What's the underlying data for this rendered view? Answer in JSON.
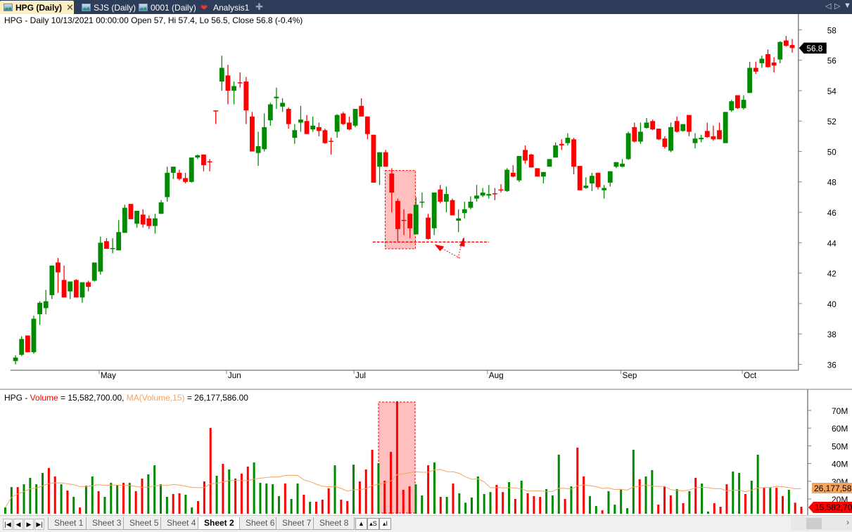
{
  "tabs": [
    {
      "label": "HPG (Daily)",
      "active": true,
      "icon": "chart-icon"
    },
    {
      "label": "SJS (Daily)",
      "active": false,
      "icon": "chart-icon"
    },
    {
      "label": "0001 (Daily)",
      "active": false,
      "icon": "chart-icon"
    },
    {
      "label": "Analysis1",
      "active": false,
      "icon": "analysis-icon"
    }
  ],
  "tab_close": "✕",
  "tab_add": "✚",
  "tab_nav": {
    "prev": "◁",
    "next": "▷",
    "menu": "▼"
  },
  "price_header": "HPG - Daily 10/13/2021 00:00:00 Open 57, Hi 57.4, Lo 56.5, Close 56.8 (-0.4%)",
  "volume_header": {
    "prefix": "HPG - ",
    "vol_label": "Volume",
    "vol_value": " = 15,582,700.00, ",
    "ma_label": "MA(Volume,15)",
    "ma_value": " = 26,177,586.00"
  },
  "price_axis": {
    "ticks": [
      36,
      38,
      40,
      42,
      44,
      46,
      48,
      50,
      52,
      54,
      56,
      58
    ],
    "last_label": "56.8"
  },
  "volume_axis": {
    "ticks": [
      {
        "v": 20,
        "l": "20M"
      },
      {
        "v": 30,
        "l": "30M"
      },
      {
        "v": 40,
        "l": "40M"
      },
      {
        "v": 50,
        "l": "50M"
      },
      {
        "v": 60,
        "l": "60M"
      },
      {
        "v": 70,
        "l": "70M"
      }
    ],
    "ma_tag": "26,177,58",
    "vol_tag": "15,582,70"
  },
  "months": [
    {
      "label": "May",
      "bar": 14
    },
    {
      "label": "Jun",
      "bar": 35
    },
    {
      "label": "Jul",
      "bar": 56
    },
    {
      "label": "Aug",
      "bar": 78
    },
    {
      "label": "Sep",
      "bar": 100
    },
    {
      "label": "Oct",
      "bar": 120
    }
  ],
  "colors": {
    "up": "#008a00",
    "down": "#ff0000",
    "ma": "#f7a35c",
    "highlight": "#ffbfbf",
    "tab_bar": "#2d3c58",
    "active_tab": "#fbeec0"
  },
  "ohlc": [
    [
      36.22,
      36.6,
      36.0,
      36.45
    ],
    [
      36.63,
      37.85,
      36.55,
      37.67
    ],
    [
      37.9,
      37.9,
      36.8,
      36.8
    ],
    [
      36.8,
      39.2,
      36.7,
      39.0
    ],
    [
      39.3,
      40.15,
      38.6,
      40.05
    ],
    [
      39.7,
      40.9,
      39.3,
      40.15
    ],
    [
      40.55,
      42.5,
      40.3,
      42.5
    ],
    [
      42.7,
      43.0,
      40.7,
      42.05
    ],
    [
      41.55,
      42.5,
      40.4,
      40.4
    ],
    [
      40.8,
      41.45,
      40.3,
      41.45
    ],
    [
      41.55,
      41.6,
      40.4,
      40.4
    ],
    [
      40.4,
      41.4,
      40.05,
      41.4
    ],
    [
      41.4,
      41.5,
      40.8,
      41.1
    ],
    [
      41.5,
      42.7,
      41.45,
      42.7
    ],
    [
      42.1,
      44.4,
      41.9,
      44.0
    ],
    [
      44.1,
      44.3,
      43.6,
      43.6
    ],
    [
      43.6,
      44.3,
      43.3,
      43.65
    ],
    [
      43.5,
      45.5,
      43.5,
      44.7
    ],
    [
      44.65,
      46.5,
      44.65,
      46.3
    ],
    [
      46.55,
      46.55,
      45.55,
      45.55
    ],
    [
      45.25,
      46.1,
      45.0,
      46.1
    ],
    [
      45.85,
      46.2,
      45.0,
      45.2
    ],
    [
      45.6,
      45.8,
      44.9,
      45.1
    ],
    [
      45.1,
      45.9,
      44.6,
      45.6
    ],
    [
      45.9,
      46.8,
      45.9,
      46.65
    ],
    [
      47.0,
      49.0,
      46.7,
      48.6
    ],
    [
      48.6,
      49.0,
      48.2,
      49.0
    ],
    [
      48.6,
      48.8,
      48.1,
      48.2
    ],
    [
      48.25,
      48.6,
      47.9,
      48.0
    ],
    [
      48.0,
      49.6,
      47.95,
      49.6
    ],
    [
      49.6,
      49.8,
      49.5,
      49.75
    ],
    [
      49.8,
      49.8,
      48.7,
      49.1
    ],
    [
      49.35,
      49.5,
      48.7,
      49.3
    ],
    [
      52.7,
      52.7,
      51.8,
      52.65
    ],
    [
      54.6,
      56.3,
      54.0,
      55.5
    ],
    [
      55.0,
      55.7,
      53.1,
      54.0
    ],
    [
      54.0,
      54.6,
      53.1,
      54.3
    ],
    [
      54.55,
      55.2,
      54.2,
      54.5
    ],
    [
      54.6,
      54.9,
      51.8,
      52.7
    ],
    [
      52.3,
      52.6,
      50.0,
      50.0
    ],
    [
      49.9,
      51.3,
      49.05,
      50.35
    ],
    [
      50.15,
      52.5,
      50.0,
      51.6
    ],
    [
      52.05,
      53.2,
      51.7,
      53.1
    ],
    [
      53.5,
      54.2,
      52.8,
      53.6
    ],
    [
      52.95,
      53.5,
      52.6,
      53.2
    ],
    [
      52.8,
      52.9,
      51.5,
      51.8
    ],
    [
      50.9,
      51.8,
      50.5,
      51.4
    ],
    [
      51.9,
      53.0,
      51.3,
      52.1
    ],
    [
      52.0,
      52.4,
      51.15,
      51.15
    ],
    [
      51.45,
      52.3,
      51.3,
      51.7
    ],
    [
      51.6,
      51.9,
      51.0,
      51.35
    ],
    [
      51.4,
      51.5,
      50.5,
      50.55
    ],
    [
      50.7,
      50.9,
      49.8,
      50.65
    ],
    [
      51.3,
      52.45,
      50.9,
      52.4
    ],
    [
      52.5,
      52.6,
      51.75,
      51.8
    ],
    [
      51.9,
      52.3,
      51.4,
      51.45
    ],
    [
      51.7,
      52.8,
      51.6,
      52.8
    ],
    [
      53.0,
      53.5,
      52.3,
      52.3
    ],
    [
      52.3,
      52.3,
      50.8,
      51.15
    ],
    [
      51.1,
      51.1,
      47.95,
      47.95
    ],
    [
      49.0,
      49.95,
      47.8,
      49.95
    ],
    [
      49.95,
      50.1,
      49.0,
      49.0
    ],
    [
      48.55,
      48.9,
      46.0,
      47.3
    ],
    [
      46.75,
      46.9,
      44.1,
      44.9
    ],
    [
      45.5,
      46.2,
      44.5,
      45.45
    ],
    [
      45.9,
      45.95,
      44.3,
      44.95
    ],
    [
      44.55,
      47.0,
      44.55,
      46.5
    ],
    [
      46.65,
      47.3,
      46.3,
      46.7
    ],
    [
      45.65,
      45.9,
      44.2,
      44.25
    ],
    [
      44.95,
      47.3,
      44.5,
      47.3
    ],
    [
      47.5,
      47.8,
      46.6,
      46.7
    ],
    [
      46.7,
      47.7,
      46.0,
      47.2
    ],
    [
      46.8,
      46.9,
      45.8,
      45.8
    ],
    [
      45.45,
      46.2,
      44.7,
      45.6
    ],
    [
      45.95,
      46.7,
      45.6,
      46.2
    ],
    [
      46.3,
      47.05,
      46.2,
      46.7
    ],
    [
      46.9,
      47.8,
      46.7,
      47.1
    ],
    [
      47.1,
      47.6,
      47.0,
      47.3
    ],
    [
      47.1,
      47.8,
      46.9,
      47.2
    ],
    [
      47.25,
      47.6,
      46.8,
      47.2
    ],
    [
      47.5,
      47.85,
      47.3,
      47.45
    ],
    [
      47.4,
      48.9,
      47.35,
      48.8
    ],
    [
      48.6,
      49.1,
      48.3,
      48.35
    ],
    [
      48.1,
      49.7,
      48.0,
      49.7
    ],
    [
      50.1,
      50.4,
      49.2,
      49.4
    ],
    [
      49.8,
      49.85,
      48.95,
      48.95
    ],
    [
      48.9,
      48.9,
      48.35,
      48.35
    ],
    [
      48.35,
      48.65,
      47.9,
      48.65
    ],
    [
      49.0,
      49.5,
      49.0,
      49.5
    ],
    [
      49.6,
      50.6,
      49.6,
      50.4
    ],
    [
      50.5,
      50.8,
      50.1,
      50.4
    ],
    [
      50.55,
      51.2,
      50.4,
      50.9
    ],
    [
      50.8,
      50.9,
      48.5,
      49.0
    ],
    [
      49.05,
      49.05,
      47.45,
      47.45
    ],
    [
      47.6,
      48.3,
      47.55,
      47.75
    ],
    [
      47.9,
      48.6,
      47.4,
      48.4
    ],
    [
      48.6,
      48.6,
      47.5,
      47.65
    ],
    [
      47.45,
      47.8,
      46.9,
      47.6
    ],
    [
      47.95,
      48.7,
      47.7,
      48.7
    ],
    [
      49.0,
      49.3,
      48.9,
      49.3
    ],
    [
      49.0,
      49.5,
      48.95,
      49.2
    ],
    [
      49.5,
      51.3,
      49.45,
      51.2
    ],
    [
      51.6,
      51.9,
      50.6,
      50.65
    ],
    [
      50.65,
      51.9,
      50.5,
      51.3
    ],
    [
      51.55,
      52.2,
      51.5,
      51.9
    ],
    [
      52.0,
      52.1,
      51.4,
      51.45
    ],
    [
      51.5,
      51.5,
      50.75,
      50.8
    ],
    [
      50.85,
      51.0,
      50.2,
      50.3
    ],
    [
      50.05,
      51.9,
      49.95,
      51.6
    ],
    [
      52.0,
      52.3,
      51.25,
      51.3
    ],
    [
      51.35,
      51.8,
      51.3,
      51.8
    ],
    [
      52.4,
      52.4,
      51.0,
      51.3
    ],
    [
      50.55,
      51.2,
      50.2,
      50.85
    ],
    [
      50.8,
      51.1,
      50.6,
      50.9
    ],
    [
      51.35,
      51.9,
      50.9,
      50.95
    ],
    [
      51.0,
      51.7,
      50.7,
      50.8
    ],
    [
      51.4,
      51.9,
      50.8,
      50.8
    ],
    [
      50.55,
      52.6,
      50.55,
      52.6
    ],
    [
      52.7,
      53.4,
      52.6,
      53.3
    ],
    [
      53.7,
      53.7,
      52.8,
      52.85
    ],
    [
      52.85,
      53.7,
      52.75,
      53.4
    ],
    [
      53.85,
      55.9,
      53.85,
      55.5
    ],
    [
      55.5,
      55.9,
      55.1,
      55.25
    ],
    [
      55.8,
      56.3,
      55.5,
      56.1
    ],
    [
      56.4,
      56.7,
      55.5,
      55.55
    ],
    [
      55.85,
      56.2,
      55.2,
      55.65
    ],
    [
      56.05,
      57.25,
      55.8,
      57.2
    ],
    [
      57.3,
      57.6,
      56.9,
      56.95
    ],
    [
      57.0,
      57.4,
      56.5,
      56.8
    ]
  ],
  "volume_millions": [
    15.2,
    26.7,
    26.7,
    28.3,
    31.9,
    28.3,
    34.7,
    37.5,
    32.7,
    28.3,
    24.8,
    21.2,
    15.2,
    27.5,
    32.7,
    24.4,
    21.2,
    29.1,
    27.9,
    29.1,
    29.1,
    24.4,
    31.5,
    33.9,
    39.0,
    28.3,
    21.2,
    22.8,
    23.2,
    22.4,
    15.2,
    18.8,
    29.9,
    60.1,
    33.1,
    39.8,
    36.7,
    31.5,
    34.3,
    38.3,
    40.6,
    29.1,
    28.7,
    28.3,
    21.6,
    28.7,
    20.0,
    28.7,
    22.4,
    18.4,
    18.4,
    19.6,
    26.0,
    39.0,
    19.6,
    18.8,
    39.4,
    29.9,
    36.7,
    47.8,
    40.2,
    30.3,
    46.6,
    75.2,
    25.2,
    27.1,
    28.3,
    22.0,
    39.0,
    40.6,
    21.2,
    21.2,
    28.7,
    23.2,
    17.9,
    20.8,
    32.7,
    22.8,
    23.9,
    27.9,
    23.9,
    29.5,
    20.0,
    30.3,
    23.2,
    21.6,
    21.2,
    25.6,
    22.0,
    45.0,
    20.0,
    27.1,
    49.0,
    32.7,
    21.6,
    16.0,
    13.6,
    24.4,
    16.8,
    25.6,
    14.8,
    47.8,
    31.1,
    32.7,
    36.3,
    16.8,
    27.1,
    22.0,
    25.6,
    17.6,
    24.4,
    31.9,
    28.7,
    12.9,
    17.6,
    15.6,
    28.3,
    35.5,
    34.7,
    22.8,
    30.3,
    45.0,
    26.3,
    26.3,
    26.3,
    21.6,
    25.2,
    17.9,
    15.58
  ],
  "sheets": [
    {
      "label": "Sheet 1"
    },
    {
      "label": "Sheet 3"
    },
    {
      "label": "Sheet 5"
    },
    {
      "label": "Sheet 4"
    },
    {
      "label": "Sheet 2",
      "active": true
    },
    {
      "label": "Sheet 6"
    },
    {
      "label": "Sheet 7"
    },
    {
      "label": "Sheet 8"
    }
  ],
  "sheet_nav": [
    "|◀",
    "◀",
    "▶",
    "▶|"
  ],
  "tools": {
    "lock": "🔒",
    "s": "▴S",
    "i": "▴I"
  },
  "scroll_right": "›"
}
